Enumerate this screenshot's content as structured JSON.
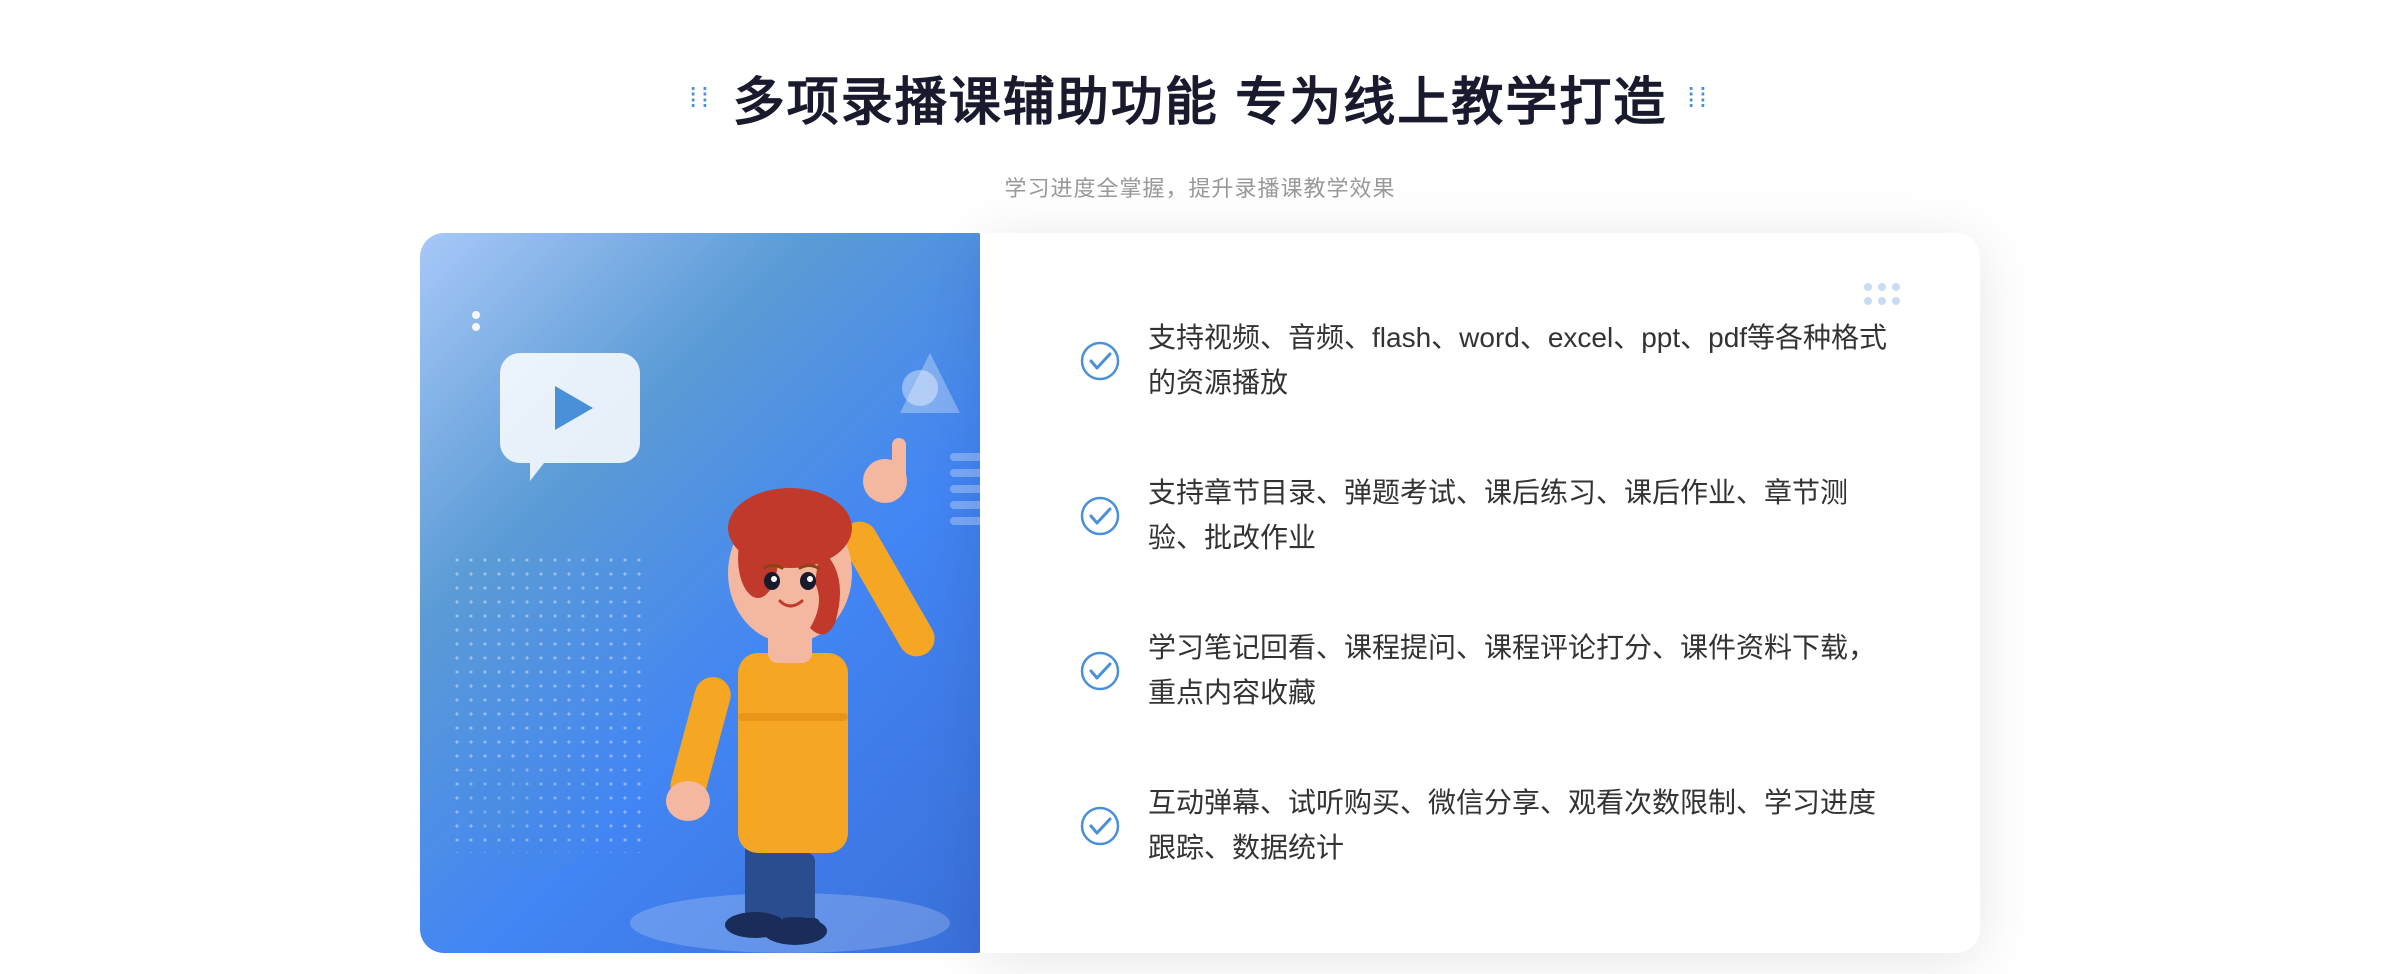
{
  "header": {
    "dots_left": "⁞⁞",
    "title": "多项录播课辅助功能 专为线上教学打造",
    "dots_right": "⁞⁞",
    "subtitle": "学习进度全掌握，提升录播课教学效果"
  },
  "features": [
    {
      "id": 1,
      "text": "支持视频、音频、flash、word、excel、ppt、pdf等各种格式的资源播放"
    },
    {
      "id": 2,
      "text": "支持章节目录、弹题考试、课后练习、课后作业、章节测验、批改作业"
    },
    {
      "id": 3,
      "text": "学习笔记回看、课程提问、课程评论打分、课件资料下载，重点内容收藏"
    },
    {
      "id": 4,
      "text": "互动弹幕、试听购买、微信分享、观看次数限制、学习进度跟踪、数据统计"
    }
  ],
  "colors": {
    "primary_blue": "#4285f4",
    "light_blue": "#a8c8f8",
    "check_color": "#4a90d9",
    "title_color": "#1a1a2e",
    "text_color": "#333333",
    "subtitle_color": "#999999"
  }
}
